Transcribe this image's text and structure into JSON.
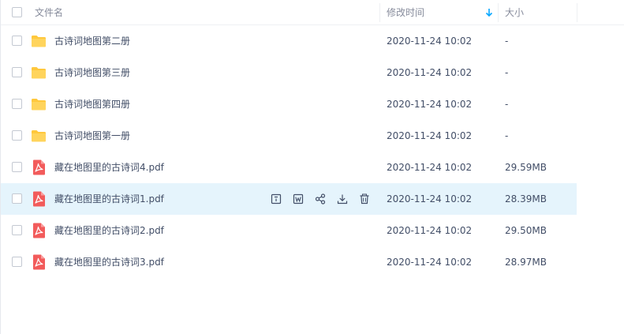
{
  "header": {
    "name_label": "文件名",
    "time_label": "修改时间",
    "size_label": "大小"
  },
  "colors": {
    "accent": "#06a7ff",
    "folder": "#ffc83d",
    "pdf": "#f25b5b",
    "row_highlight": "#e5f4fc",
    "text": "#424e67",
    "header_text": "#878c9c"
  },
  "files": [
    {
      "name": "古诗词地图第二册",
      "time": "2020-11-24 10:02",
      "size": "-",
      "type": "folder-icon"
    },
    {
      "name": "古诗词地图第三册",
      "time": "2020-11-24 10:02",
      "size": "-",
      "type": "folder-icon"
    },
    {
      "name": "古诗词地图第四册",
      "time": "2020-11-24 10:02",
      "size": "-",
      "type": "folder-icon"
    },
    {
      "name": "古诗词地图第一册",
      "time": "2020-11-24 10:02",
      "size": "-",
      "type": "folder-icon"
    },
    {
      "name": "藏在地图里的古诗词4.pdf",
      "time": "2020-11-24 10:02",
      "size": "29.59MB",
      "type": "pdf-icon"
    },
    {
      "name": "藏在地图里的古诗词1.pdf",
      "time": "2020-11-24 10:02",
      "size": "28.39MB",
      "type": "pdf-icon",
      "hovered": true
    },
    {
      "name": "藏在地图里的古诗词2.pdf",
      "time": "2020-11-24 10:02",
      "size": "29.50MB",
      "type": "pdf-icon"
    },
    {
      "name": "藏在地图里的古诗词3.pdf",
      "time": "2020-11-24 10:02",
      "size": "28.97MB",
      "type": "pdf-icon"
    }
  ],
  "row_actions": [
    "save-to-disk-icon",
    "word-convert-icon",
    "share-icon",
    "download-icon",
    "delete-icon"
  ]
}
